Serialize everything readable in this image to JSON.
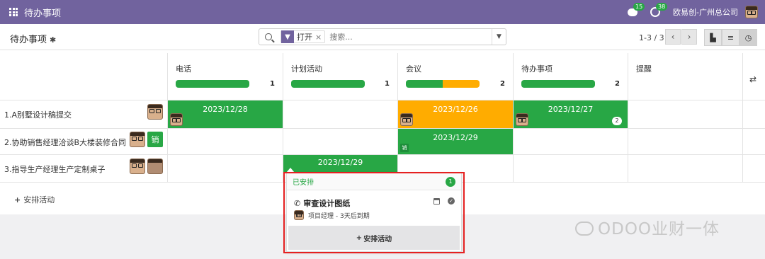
{
  "app": {
    "title": "待办事项",
    "chat_count": "15",
    "activity_count": "38",
    "company": "欧易创-广州总公司"
  },
  "control": {
    "breadcrumb": "待办事项",
    "filter_value": "打开",
    "filter_remove": "×",
    "search_placeholder": "搜索...",
    "pager": "1-3 / 3",
    "prev": "‹",
    "next": "›"
  },
  "columns": [
    {
      "label": "电话",
      "count": "1"
    },
    {
      "label": "计划活动",
      "count": "1"
    },
    {
      "label": "会议",
      "count": "2"
    },
    {
      "label": "待办事项",
      "count": "2"
    },
    {
      "label": "提醒",
      "count": ""
    }
  ],
  "column_progress": [
    {
      "planned": 1,
      "today": 0,
      "overdue": 0
    },
    {
      "planned": 1,
      "today": 0,
      "overdue": 0
    },
    {
      "planned": 1,
      "today": 1,
      "overdue": 0
    },
    {
      "planned": 1,
      "today": 0,
      "overdue": 0
    }
  ],
  "rows": [
    {
      "label": "1.A别墅设计稿提交"
    },
    {
      "label": "2.协助销售经理洽谈B大楼装修合同",
      "badge": "销"
    },
    {
      "label": "3.指导生产经理生产定制桌子"
    }
  ],
  "cells": {
    "r1_phone": {
      "date": "2023/12/28",
      "state": "planned"
    },
    "r1_meeting": {
      "date": "2023/12/26",
      "state": "today"
    },
    "r1_todo": {
      "date": "2023/12/27",
      "state": "planned",
      "count": "2"
    },
    "r2_meeting": {
      "date": "2023/12/29",
      "state": "planned",
      "tag": "销"
    },
    "r3_plan": {
      "date": "2023/12/29",
      "state": "planned"
    }
  },
  "schedule_button": "安排活动",
  "popover": {
    "header": "已安排",
    "count": "1",
    "activity_title": "审查设计图纸",
    "activity_sub": "项目经理 - 3天后到期",
    "button": "安排活动"
  },
  "colors": {
    "navbar": "#71639e",
    "planned": "#28a745",
    "today": "#ffac00",
    "highlight": "#e52121"
  },
  "icons": [
    "apps-icon",
    "chat-icon",
    "activity-clock-icon",
    "gear-icon",
    "search-icon",
    "filter-icon",
    "kanban-icon",
    "list-icon",
    "activity-view-icon",
    "settings-sliders-icon",
    "phone-icon",
    "calendar-icon",
    "check-icon",
    "plus-icon"
  ],
  "watermark": "ODOO业财一体"
}
